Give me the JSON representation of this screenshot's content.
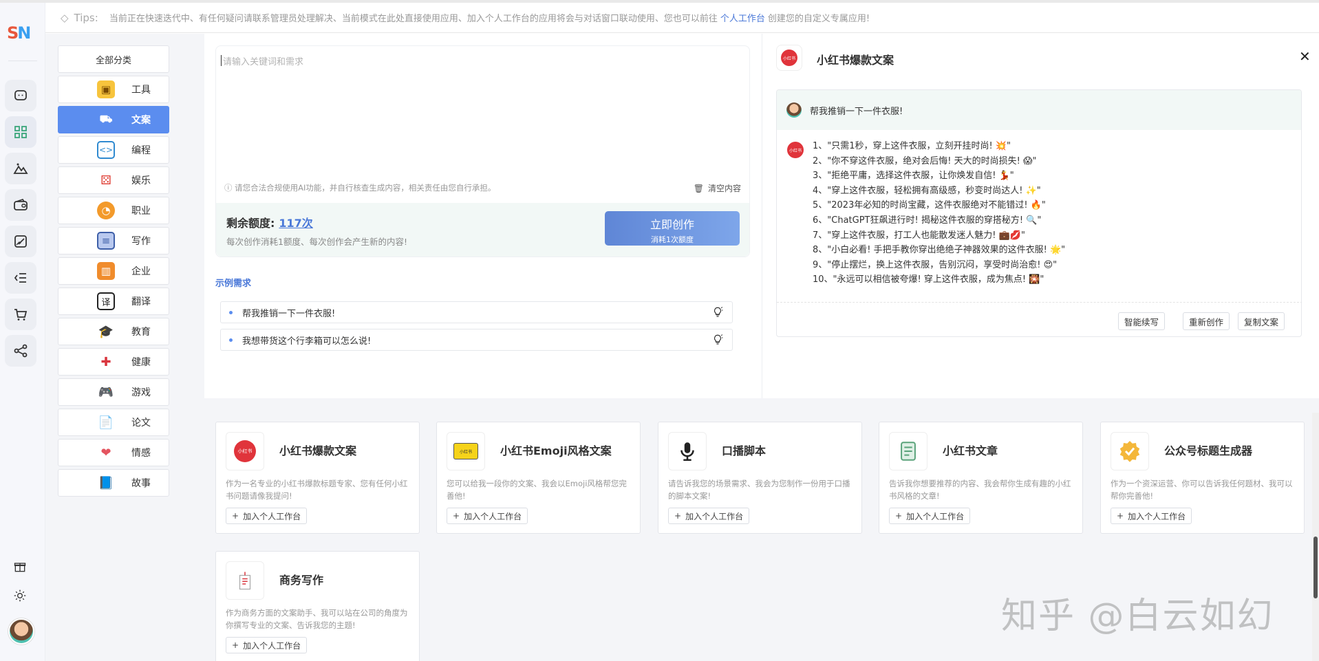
{
  "app": {
    "logo_text_s": "S",
    "logo_text_n": "N",
    "accent_color": "#5b8def"
  },
  "tips": {
    "label": "Tips:",
    "text_before": "当前正在快速迭代中、有任何疑问请联系管理员处理解决、当前模式在此处直接使用应用、加入个人工作台的应用将会与对话窗口联动使用、您也可以前往",
    "link": "个人工作台",
    "text_after": "创建您的自定义专属应用!"
  },
  "categories": [
    {
      "label": "全部分类",
      "icon": ""
    },
    {
      "label": "工具",
      "icon": "toolbox-icon"
    },
    {
      "label": "文案",
      "icon": "copywriting-icon"
    },
    {
      "label": "编程",
      "icon": "code-icon"
    },
    {
      "label": "娱乐",
      "icon": "dice-icon"
    },
    {
      "label": "职业",
      "icon": "career-icon"
    },
    {
      "label": "写作",
      "icon": "writing-icon"
    },
    {
      "label": "企业",
      "icon": "building-icon"
    },
    {
      "label": "翻译",
      "icon": "translate-icon"
    },
    {
      "label": "教育",
      "icon": "graduation-icon"
    },
    {
      "label": "健康",
      "icon": "health-icon"
    },
    {
      "label": "游戏",
      "icon": "gamepad-icon"
    },
    {
      "label": "论文",
      "icon": "paper-icon"
    },
    {
      "label": "情感",
      "icon": "heart-icon"
    },
    {
      "label": "故事",
      "icon": "book-icon"
    }
  ],
  "active_category": "文案",
  "input": {
    "placeholder": "请输入关键词和需求",
    "notice": "请您合法合规使用AI功能，并自行核查生成内容，相关责任由您自行承担。",
    "clear_label": "清空内容"
  },
  "quota": {
    "label": "剩余额度:",
    "value": "117次",
    "note": "每次创作消耗1额度、每次创作会产生新的内容!",
    "create_label": "立即创作",
    "create_sub": "消耗1次额度"
  },
  "examples": {
    "title": "示例需求",
    "items": [
      "帮我推销一下一件衣服!",
      "我想带货这个行李箱可以怎么说!"
    ]
  },
  "chat": {
    "title": "小红书爆款文案",
    "user_message": "帮我推销一下一件衣服!",
    "bot_lines": [
      "1、\"只需1秒，穿上这件衣服，立刻开挂时尚! 💥\"",
      "2、\"你不穿这件衣服，绝对会后悔! 天大的时尚损失! 😱\"",
      "3、\"拒绝平庸，选择这件衣服，让你焕发自信! 💃\"",
      "4、\"穿上这件衣服，轻松拥有高级感，秒变时尚达人! ✨\"",
      "5、\"2023年必知的时尚宝藏，这件衣服绝对不能错过! 🔥\"",
      "6、\"ChatGPT狂飙进行时! 揭秘这件衣服的穿搭秘方! 🔍\"",
      "7、\"穿上这件衣服，打工人也能散发迷人魅力! 💼💋\"",
      "8、\"小白必看! 手把手教你穿出绝绝子神器效果的这件衣服! 🌟\"",
      "9、\"停止摆烂，换上这件衣服，告别沉闷，享受时尚治愈! 😍\"",
      "10、\"永远可以相信被夸爆! 穿上这件衣服，成为焦点! 🎇\""
    ],
    "buttons": [
      "智能续写",
      "重新创作",
      "复制文案"
    ]
  },
  "cards": [
    {
      "title": "小红书爆款文案",
      "desc": "作为一名专业的小红书爆款标题专家、您有任何小红书问题请像我提问!",
      "add": "加入个人工作台",
      "icon": "xiaohongshu-icon"
    },
    {
      "title": "小红书Emoji风格文案",
      "desc": "您可以给我一段你的文案、我会以Emoji风格帮您完善他!",
      "add": "加入个人工作台",
      "icon": "xiaohongshu-emoji-icon"
    },
    {
      "title": "口播脚本",
      "desc": "请告诉我您的场景需求、我会为您制作一份用于口播的脚本文案!",
      "add": "加入个人工作台",
      "icon": "microphone-icon"
    },
    {
      "title": "小红书文章",
      "desc": "告诉我你想要推荐的内容、我会帮你生成有趣的小红书风格的文章!",
      "add": "加入个人工作台",
      "icon": "notebook-icon"
    },
    {
      "title": "公众号标题生成器",
      "desc": "作为一个资深运营、你可以告诉我任何题材、我可以帮你完善他!",
      "add": "加入个人工作台",
      "icon": "badge-check-icon"
    },
    {
      "title": "商务写作",
      "desc": "作为商务方面的文案助手、我可以站在公司的角度为你撰写专业的文案、告诉我您的主题!",
      "add": "加入个人工作台",
      "icon": "business-writing-icon"
    }
  ],
  "watermark": "知乎 @白云如幻",
  "xhs_logo_text": "小红书"
}
